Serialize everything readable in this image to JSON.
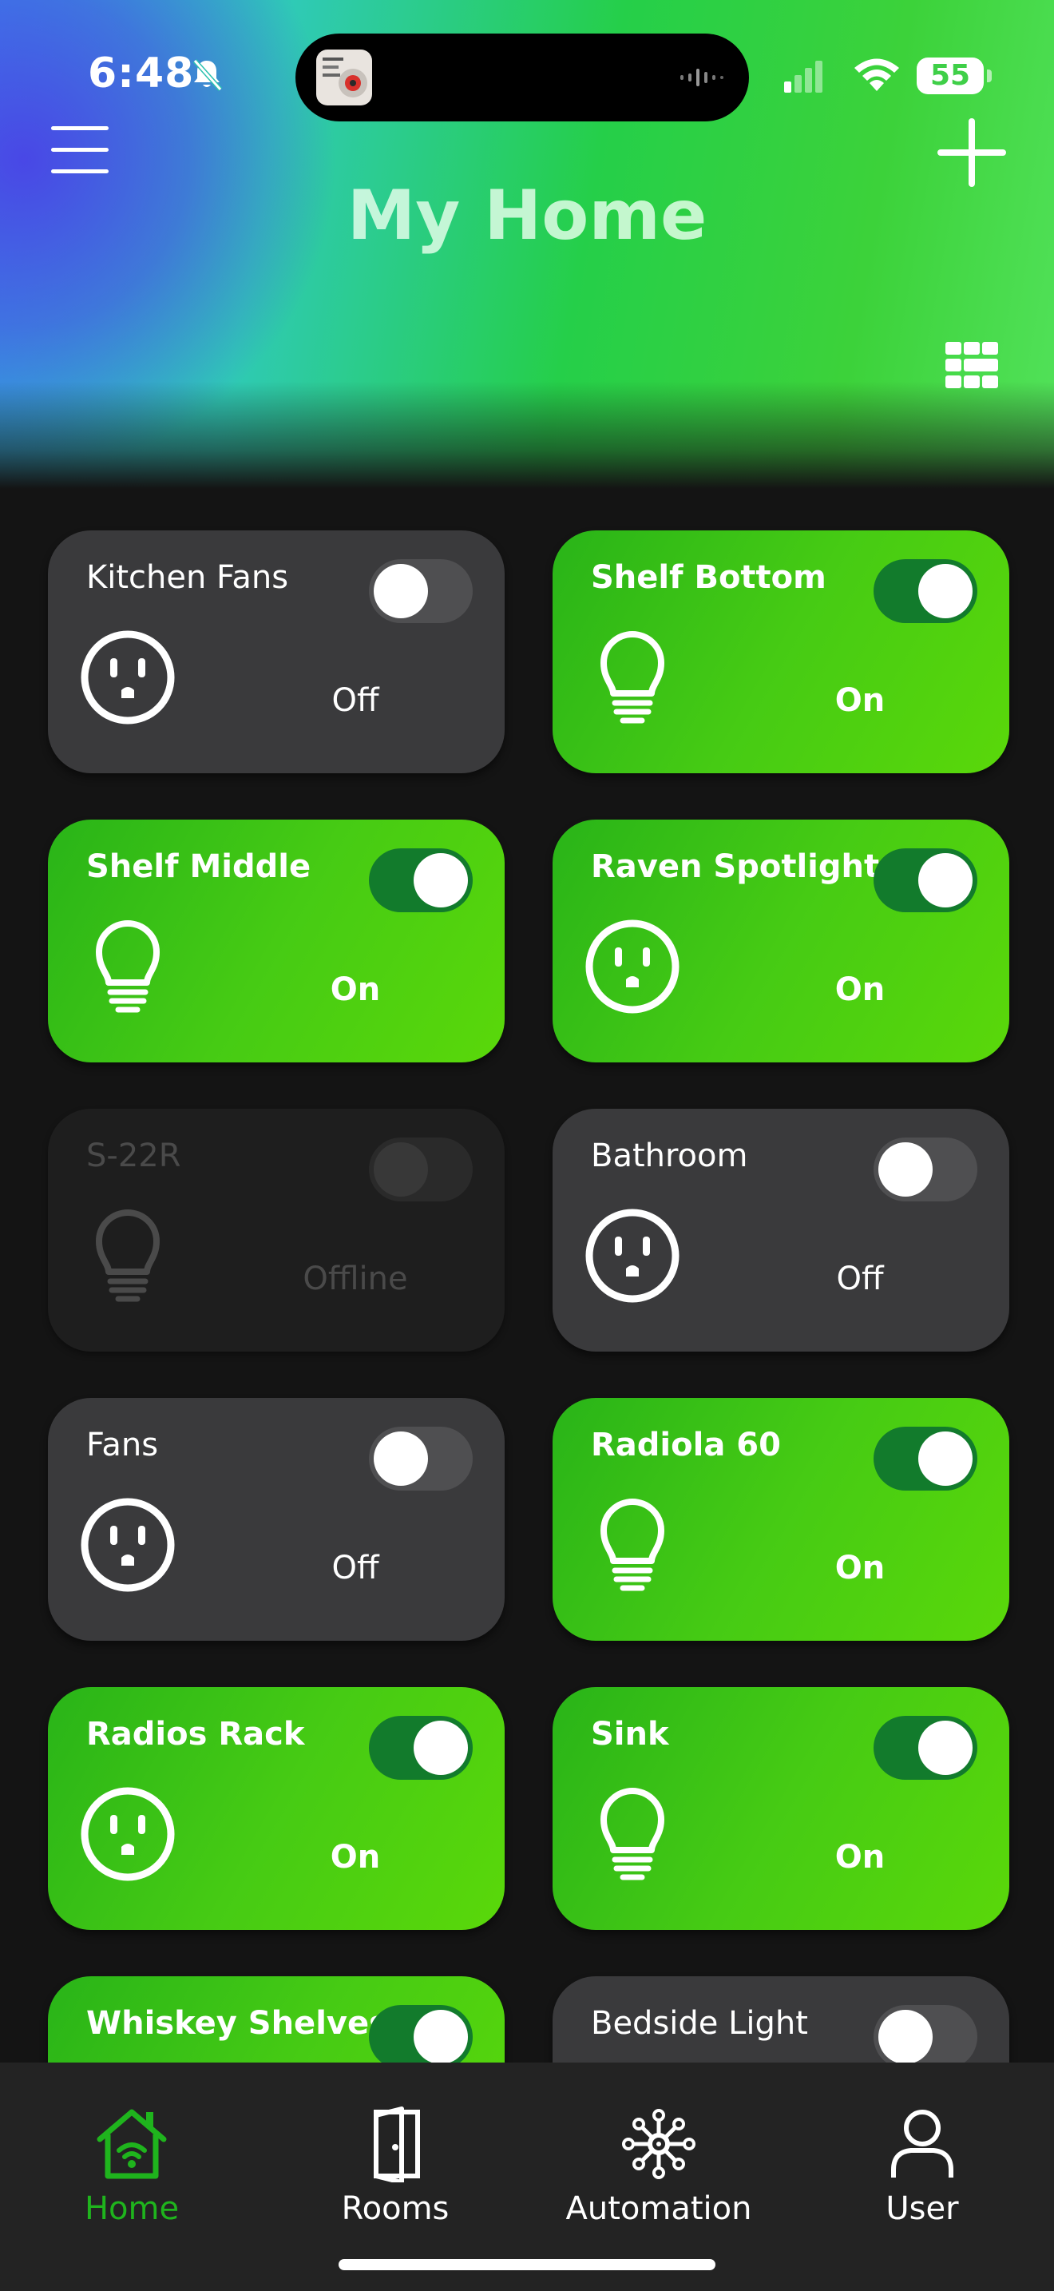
{
  "status_bar": {
    "time": "6:48",
    "battery": "55",
    "icons": [
      "bell-slash-icon",
      "signal-icon",
      "wifi-icon",
      "battery-icon"
    ]
  },
  "header": {
    "title": "My Home",
    "icons": [
      "menu-icon",
      "plus-icon",
      "grid-view-icon"
    ]
  },
  "colors": {
    "accent_green": "#45c914",
    "toggle_on": "#127b2c",
    "card_off": "#3a3a3c",
    "card_offline": "#1e1e1e",
    "tab_active": "#1fb41d"
  },
  "devices": [
    {
      "name": "Kitchen Fans",
      "status": "Off",
      "icon": "outlet-icon",
      "state": "off"
    },
    {
      "name": "Shelf Bottom",
      "status": "On",
      "icon": "bulb-icon",
      "state": "on"
    },
    {
      "name": "Shelf Middle",
      "status": "On",
      "icon": "bulb-icon",
      "state": "on"
    },
    {
      "name": "Raven Spotlight",
      "status": "On",
      "icon": "outlet-icon",
      "state": "on"
    },
    {
      "name": "S-22R",
      "status": "Offline",
      "icon": "bulb-icon",
      "state": "offline"
    },
    {
      "name": "Bathroom",
      "status": "Off",
      "icon": "outlet-icon",
      "state": "off"
    },
    {
      "name": "Fans",
      "status": "Off",
      "icon": "outlet-icon",
      "state": "off"
    },
    {
      "name": "Radiola 60",
      "status": "On",
      "icon": "bulb-icon",
      "state": "on"
    },
    {
      "name": "Radios Rack",
      "status": "On",
      "icon": "outlet-icon",
      "state": "on"
    },
    {
      "name": "Sink",
      "status": "On",
      "icon": "bulb-icon",
      "state": "on"
    },
    {
      "name": "Whiskey Shelves",
      "status": "",
      "icon": "",
      "state": "on"
    },
    {
      "name": "Bedside Light",
      "status": "",
      "icon": "",
      "state": "off"
    }
  ],
  "tabbar": {
    "tabs": [
      {
        "label": "Home",
        "icon": "home-wifi-icon",
        "active": true
      },
      {
        "label": "Rooms",
        "icon": "door-icon",
        "active": false
      },
      {
        "label": "Automation",
        "icon": "automation-hub-icon",
        "active": false
      },
      {
        "label": "User",
        "icon": "user-icon",
        "active": false
      }
    ]
  }
}
